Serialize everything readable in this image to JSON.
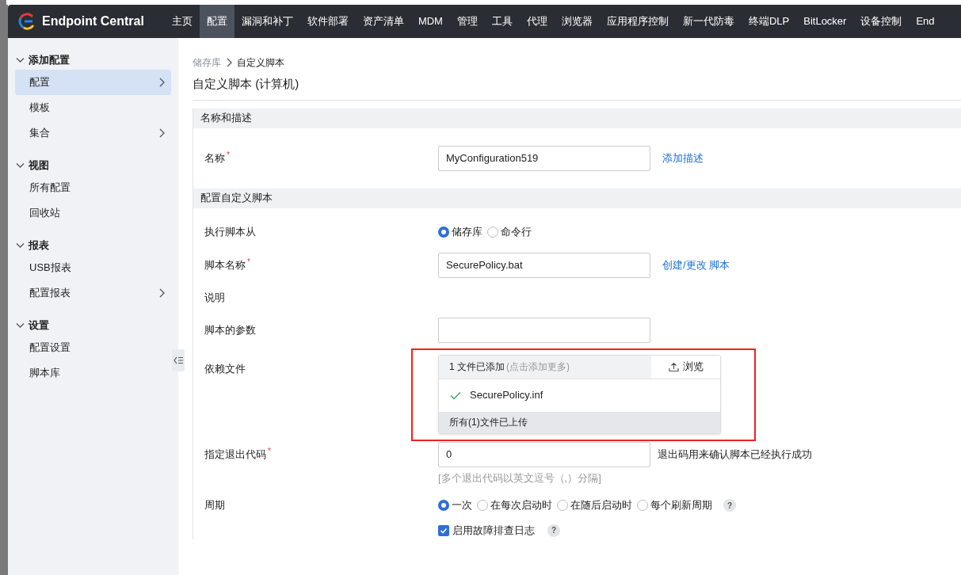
{
  "topbar": {
    "product": "Endpoint Central",
    "items": [
      {
        "label": "主页",
        "selected": false
      },
      {
        "label": "配置",
        "selected": true
      },
      {
        "label": "漏洞和补丁",
        "selected": false
      },
      {
        "label": "软件部署",
        "selected": false
      },
      {
        "label": "资产清单",
        "selected": false
      },
      {
        "label": "MDM",
        "selected": false
      },
      {
        "label": "管理",
        "selected": false
      },
      {
        "label": "工具",
        "selected": false
      },
      {
        "label": "代理",
        "selected": false
      },
      {
        "label": "浏览器",
        "selected": false
      },
      {
        "label": "应用程序控制",
        "selected": false
      },
      {
        "label": "新一代防毒",
        "selected": false
      },
      {
        "label": "终端DLP",
        "selected": false
      },
      {
        "label": "BitLocker",
        "selected": false
      },
      {
        "label": "设备控制",
        "selected": false
      },
      {
        "label": "End",
        "selected": false
      }
    ]
  },
  "sidebar": {
    "groups": [
      {
        "title": "添加配置",
        "expanded": true,
        "items": [
          {
            "label": "配置",
            "selected": true,
            "submenu": true
          },
          {
            "label": "模板",
            "selected": false,
            "submenu": false
          },
          {
            "label": "集合",
            "selected": false,
            "submenu": true
          }
        ]
      },
      {
        "title": "视图",
        "expanded": true,
        "items": [
          {
            "label": "所有配置",
            "selected": false,
            "submenu": false
          },
          {
            "label": "回收站",
            "selected": false,
            "submenu": false
          }
        ]
      },
      {
        "title": "报表",
        "expanded": true,
        "items": [
          {
            "label": "USB报表",
            "selected": false,
            "submenu": false
          },
          {
            "label": "配置报表",
            "selected": false,
            "submenu": true
          }
        ]
      },
      {
        "title": "设置",
        "expanded": true,
        "items": [
          {
            "label": "配置设置",
            "selected": false,
            "submenu": false
          },
          {
            "label": "脚本库",
            "selected": false,
            "submenu": false
          }
        ]
      }
    ]
  },
  "breadcrumb": [
    "储存库",
    "自定义脚本"
  ],
  "page_title": "自定义脚本 (计算机)",
  "sections": [
    {
      "title": "名称和描述",
      "fields": [
        {
          "kind": "input",
          "label": "名称",
          "required": "*",
          "value": "MyConfiguration519",
          "link": "添加描述"
        }
      ]
    },
    {
      "title": "配置自定义脚本",
      "fields": [
        {
          "kind": "radio",
          "label": "执行脚本从",
          "options": [
            {
              "label": "储存库",
              "selected": true
            },
            {
              "label": "命令行",
              "selected": false
            }
          ]
        },
        {
          "kind": "input",
          "label": "脚本名称",
          "required": "*",
          "value": "SecurePolicy.bat",
          "link": "创建/更改 脚本"
        },
        {
          "kind": "plain",
          "label": "说明"
        },
        {
          "kind": "input",
          "label": "脚本的参数"
        },
        {
          "kind": "files",
          "label": "依赖文件",
          "summary": "1 文件已添加",
          "summary_hint": "(点击添加更多)",
          "button": "浏览",
          "files": [
            {
              "name": "SecurePolicy.inf",
              "uploaded": true
            }
          ],
          "status": "所有(1)文件已上传",
          "highlighted": true
        },
        {
          "kind": "input",
          "label": "指定退出代码",
          "required": "*",
          "value": "0",
          "note": "退出码用来确认脚本已经执行成功",
          "hint": "[多个退出代码以英文逗号（,）分隔]"
        },
        {
          "kind": "radio",
          "label": "周期",
          "options": [
            {
              "label": "一次",
              "selected": true
            },
            {
              "label": "在每次启动时",
              "selected": false
            },
            {
              "label": "在随后启动时",
              "selected": false
            },
            {
              "label": "每个刷新周期",
              "selected": false
            }
          ],
          "help": "?"
        },
        {
          "kind": "checkbox",
          "option": "启用故障排查日志",
          "checked": true,
          "help": "?"
        }
      ]
    }
  ]
}
